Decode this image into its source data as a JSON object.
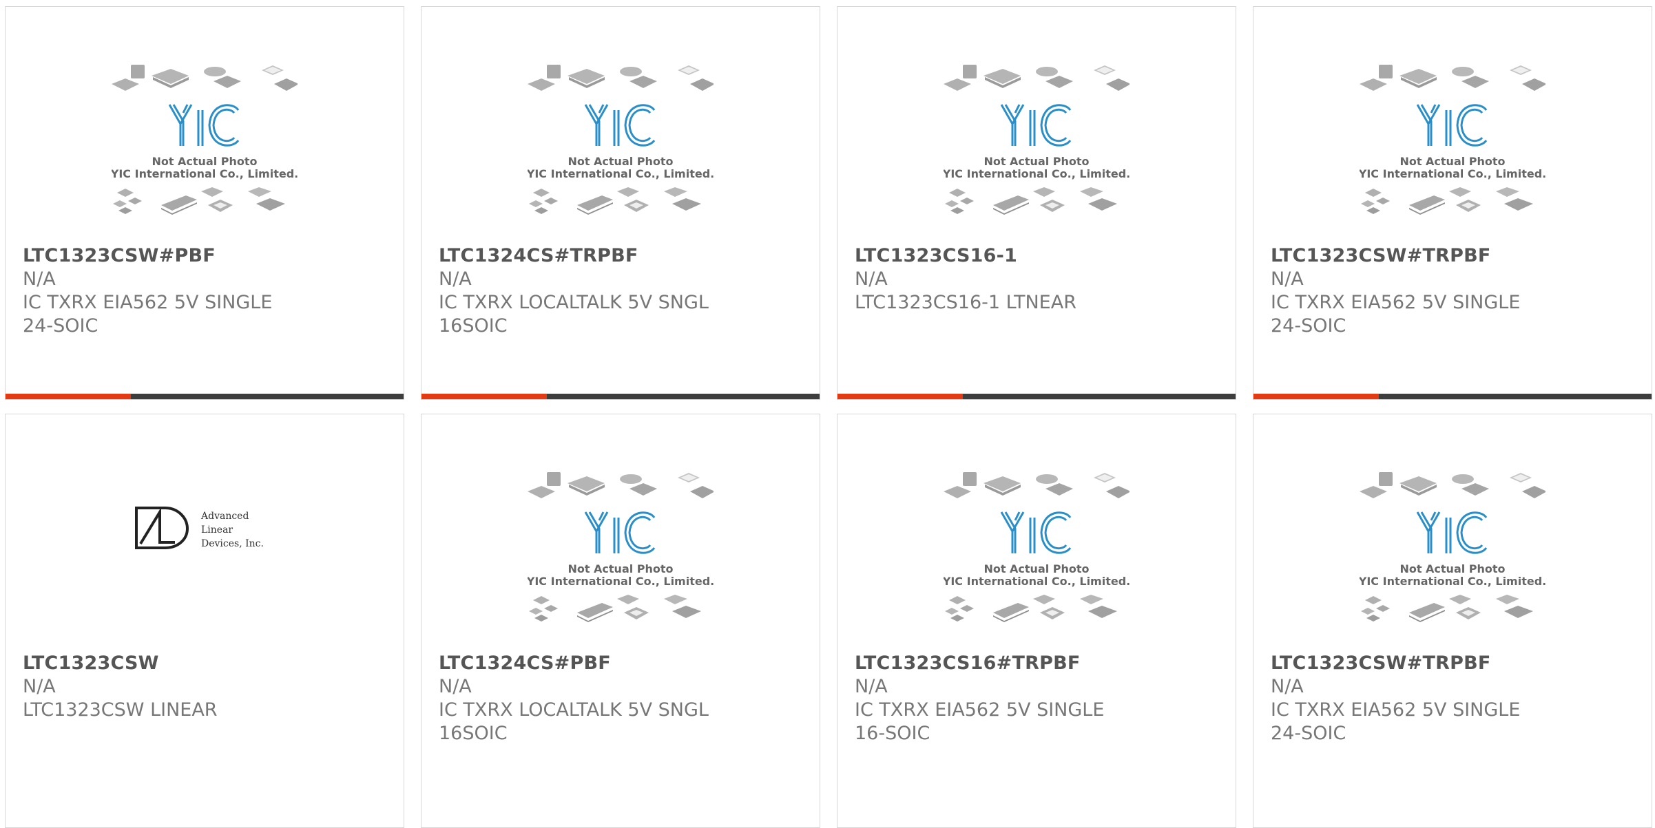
{
  "products": [
    {
      "part_number": "LTC1323CSW#PBF",
      "manufacturer": "N/A",
      "description": "IC TXRX EIA562 5V SINGLE 24-SOIC",
      "image": "placeholder",
      "image_caption_1": "Not Actual Photo",
      "image_caption_2": "YIC International Co., Limited."
    },
    {
      "part_number": "LTC1324CS#TRPBF",
      "manufacturer": "N/A",
      "description": "IC TXRX LOCALTALK 5V SNGL 16SOIC",
      "image": "placeholder",
      "image_caption_1": "Not Actual Photo",
      "image_caption_2": "YIC International Co., Limited."
    },
    {
      "part_number": "LTC1323CS16-1",
      "manufacturer": "N/A",
      "description": "LTC1323CS16-1 LTNEAR",
      "image": "placeholder",
      "image_caption_1": "Not Actual Photo",
      "image_caption_2": "YIC International Co., Limited."
    },
    {
      "part_number": "LTC1323CSW#TRPBF",
      "manufacturer": "N/A",
      "description": "IC TXRX EIA562 5V SINGLE 24-SOIC",
      "image": "placeholder",
      "image_caption_1": "Not Actual Photo",
      "image_caption_2": "YIC International Co., Limited."
    },
    {
      "part_number": "LTC1323CSW",
      "manufacturer": "N/A",
      "description": "LTC1323CSW LINEAR",
      "image": "ald-logo",
      "logo_line_1": "Advanced",
      "logo_line_2": "Linear",
      "logo_line_3": "Devices, Inc."
    },
    {
      "part_number": "LTC1324CS#PBF",
      "manufacturer": "N/A",
      "description": "IC TXRX LOCALTALK 5V SNGL 16SOIC",
      "image": "placeholder",
      "image_caption_1": "Not Actual Photo",
      "image_caption_2": "YIC International Co., Limited."
    },
    {
      "part_number": "LTC1323CS16#TRPBF",
      "manufacturer": "N/A",
      "description": "IC TXRX EIA562 5V SINGLE 16-SOIC",
      "image": "placeholder",
      "image_caption_1": "Not Actual Photo",
      "image_caption_2": "YIC International Co., Limited."
    },
    {
      "part_number": "LTC1323CSW#TRPBF",
      "manufacturer": "N/A",
      "description": "IC TXRX EIA562 5V SINGLE 24-SOIC",
      "image": "placeholder",
      "image_caption_1": "Not Actual Photo",
      "image_caption_2": "YIC International Co., Limited."
    }
  ],
  "colors": {
    "accent": "#e23b14",
    "bar": "#3d3d3d",
    "border": "#d6d6d6",
    "title_text": "#555555",
    "body_text": "#777777",
    "yic_logo": "#2a8fc9"
  }
}
